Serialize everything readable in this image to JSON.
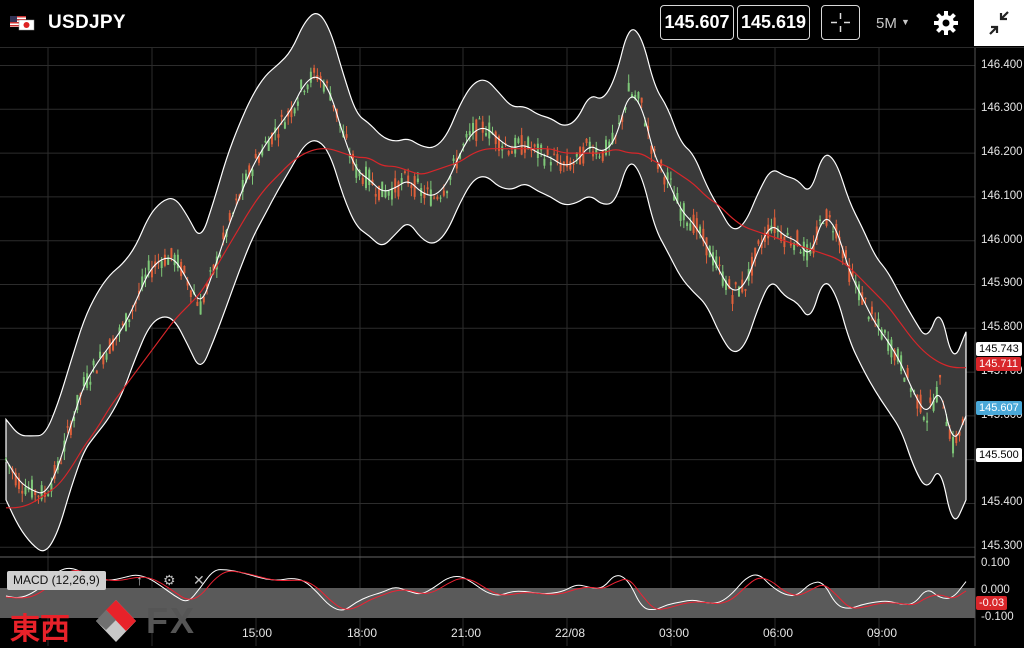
{
  "header": {
    "symbol": "USDJPY",
    "bid": "145.607",
    "ask": "145.619",
    "timeframe": "5M",
    "icons": [
      "us-flag-icon",
      "jp-flag-icon",
      "crosshair-icon",
      "chevron-down-icon",
      "gear-icon",
      "collapse-icon"
    ]
  },
  "price_axis": {
    "ticks": [
      "146.400",
      "146.300",
      "146.200",
      "146.100",
      "146.000",
      "145.900",
      "145.800",
      "145.700",
      "145.600",
      "145.500",
      "145.400",
      "145.300"
    ],
    "tags": {
      "upper_band": "145.743",
      "ma": "145.711",
      "last": "145.607",
      "lower": "145.500"
    }
  },
  "macd": {
    "label": "MACD (12,26,9)",
    "ticks": [
      "0.100",
      "0.000",
      "-0.100"
    ],
    "value_tag": "-0.03",
    "icons": [
      "arrow-up-icon",
      "gear-icon",
      "close-icon"
    ]
  },
  "time_axis": [
    "15:00",
    "18:00",
    "21:00",
    "22/08",
    "03:00",
    "06:00",
    "09:00"
  ],
  "logo": {
    "kanji": "東西",
    "fx": "FX"
  },
  "colors": {
    "ma_line": "#d8262a",
    "band_fill": "#3c3c3c",
    "bull": "#7ec878",
    "bear": "#e0603a",
    "last_tag": "#4aa8d8"
  },
  "chart_data": {
    "type": "line",
    "title": "",
    "xlabel": "",
    "ylabel": "",
    "ylim": [
      145.3,
      146.44
    ],
    "x_ticks": [
      "15:00",
      "18:00",
      "21:00",
      "22/08",
      "03:00",
      "06:00",
      "09:00"
    ],
    "x": [
      0,
      0.3,
      0.6,
      0.9,
      1.2,
      1.5,
      1.8,
      2.1,
      2.4,
      2.7,
      3.0,
      3.3,
      3.6,
      3.9,
      4.2,
      4.5,
      4.8,
      5.1,
      5.4,
      5.7,
      6.0,
      6.3,
      6.6,
      6.9,
      7.2,
      7.5,
      7.8,
      8.1,
      8.4,
      8.7,
      9.0,
      9.3,
      9.6,
      9.9,
      10.2,
      10.5,
      10.8,
      11.1,
      11.4,
      11.7,
      12.0,
      12.3,
      12.6,
      12.9,
      13.2,
      13.5,
      13.8,
      14.1,
      14.4,
      14.7,
      15.0,
      15.3,
      15.6,
      15.9,
      16.2,
      16.5,
      16.8,
      17.1,
      17.4,
      17.7,
      18.0,
      18.3,
      18.6,
      18.9,
      19.2,
      19.5,
      19.8,
      20.1,
      20.4,
      20.7,
      21.0,
      21.3,
      21.6,
      21.9,
      22.2
    ],
    "series": [
      {
        "values": [
          145.5,
          145.45,
          145.43,
          145.42,
          145.48,
          145.58,
          145.67,
          145.72,
          145.76,
          145.8,
          145.86,
          145.93,
          145.96,
          145.96,
          145.91,
          145.85,
          145.93,
          146.02,
          146.1,
          146.17,
          146.22,
          146.26,
          146.3,
          146.36,
          146.38,
          146.34,
          146.24,
          146.16,
          146.14,
          146.11,
          146.12,
          146.14,
          146.11,
          146.1,
          146.13,
          146.2,
          146.25,
          146.26,
          146.23,
          146.21,
          146.22,
          146.2,
          146.19,
          146.17,
          146.18,
          146.22,
          146.2,
          146.23,
          146.34,
          146.31,
          146.19,
          146.14,
          146.07,
          146.04,
          145.99,
          145.93,
          145.88,
          145.9,
          145.98,
          146.04,
          146.01,
          146.0,
          145.96,
          146.06,
          146.03,
          145.93,
          145.87,
          145.81,
          145.77,
          145.72,
          145.65,
          145.6,
          145.67,
          145.53,
          145.6
        ]
      },
      {
        "values": [
          145.39,
          145.39,
          145.4,
          145.42,
          145.44,
          145.48,
          145.53,
          145.57,
          145.62,
          145.66,
          145.7,
          145.74,
          145.78,
          145.82,
          145.85,
          145.88,
          145.93,
          145.98,
          146.03,
          146.08,
          146.12,
          146.15,
          146.18,
          146.2,
          146.21,
          146.21,
          146.2,
          146.19,
          146.19,
          146.17,
          146.17,
          146.16,
          146.15,
          146.16,
          146.17,
          146.18,
          146.2,
          146.21,
          146.21,
          146.21,
          146.21,
          146.21,
          146.21,
          146.2,
          146.2,
          146.2,
          146.2,
          146.21,
          146.2,
          146.2,
          146.18,
          146.17,
          146.15,
          146.13,
          146.1,
          146.08,
          146.05,
          146.03,
          146.02,
          146.01,
          146.0,
          145.99,
          145.98,
          145.97,
          145.96,
          145.94,
          145.91,
          145.88,
          145.85,
          145.81,
          145.77,
          145.74,
          145.72,
          145.71,
          145.71
        ]
      }
    ]
  }
}
